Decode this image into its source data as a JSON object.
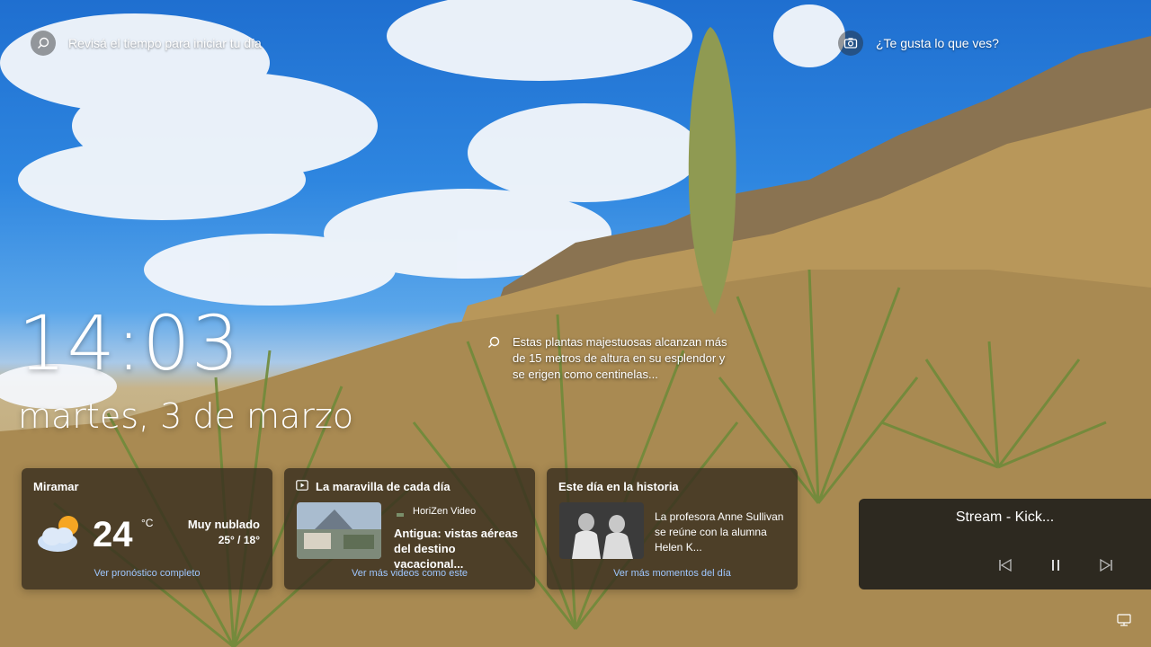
{
  "search": {
    "label": "Revisá el tiempo para iniciar tu día"
  },
  "like": {
    "label": "¿Te gusta lo que ves?"
  },
  "clock": {
    "time": "14:03",
    "date": "martes, 3 de marzo"
  },
  "caption": {
    "text": "Estas plantas majestuosas alcanzan más de 15 metros de altura en su esplendor y se erigen como centinelas..."
  },
  "weather": {
    "title": "Miramar",
    "temp": "24",
    "unit": "°C",
    "condition": "Muy nublado",
    "range": "25° / 18°",
    "link": "Ver pronóstico completo"
  },
  "video": {
    "title": "La maravilla de cada día",
    "source": "HoriZen Video",
    "headline": "Antigua: vistas aéreas del destino vacacional...",
    "link": "Ver más videos como este"
  },
  "history": {
    "title": "Este día en la historia",
    "text": "La profesora Anne Sullivan se reúne con la alumna Helen K...",
    "link": "Ver más momentos del día"
  },
  "media": {
    "title": "Stream - Kick..."
  },
  "colors": {
    "link": "#9fc7ff",
    "card_bg": "#382e1e"
  }
}
